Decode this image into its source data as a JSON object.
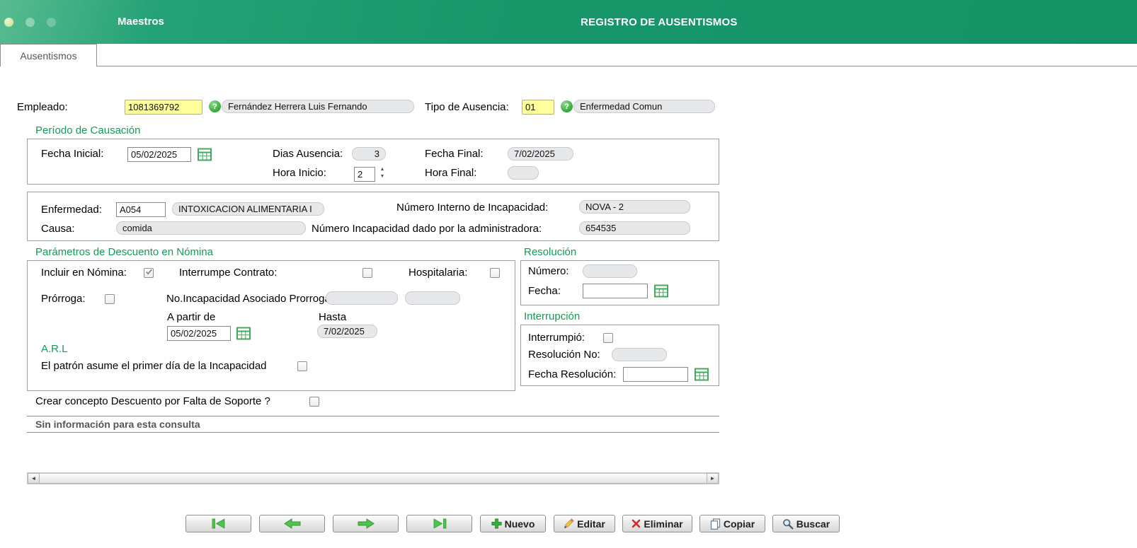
{
  "header": {
    "app_title": "Maestros",
    "screen_title": "REGISTRO DE AUSENTISMOS"
  },
  "tabs": {
    "ausentismos": "Ausentismos"
  },
  "icons": {
    "help_glyph": "?",
    "spin_up": "▲",
    "spin_down": "▼",
    "scroll_left": "◄",
    "scroll_right": "►"
  },
  "empleado": {
    "label": "Empleado:",
    "code": "1081369792",
    "name": "Fernández Herrera Luis Fernando",
    "tipo_label": "Tipo de Ausencia:",
    "tipo_code": "01",
    "tipo_name": "Enfermedad Comun"
  },
  "periodo": {
    "title": "Período de Causación",
    "fecha_inicial_label": "Fecha Inicial:",
    "fecha_inicial": "05/02/2025",
    "dias_label": "Dias Ausencia:",
    "dias": "3",
    "fecha_final_label": "Fecha Final:",
    "fecha_final": "7/02/2025",
    "hora_inicio_label": "Hora Inicio:",
    "hora_inicio": "2",
    "hora_final_label": "Hora Final:",
    "hora_final": ""
  },
  "incapacidad": {
    "enfermedad_label": "Enfermedad:",
    "enfermedad_code": "A054",
    "enfermedad_desc": "INTOXICACION ALIMENTARIA I",
    "num_interno_label": "Número Interno de Incapacidad:",
    "num_interno": "NOVA - 2",
    "causa_label": "Causa:",
    "causa": "comida",
    "num_admin_label": "Número Incapacidad dado por la administradora:",
    "num_admin": "654535"
  },
  "parametros": {
    "title": "Parámetros de Descuento en Nómina",
    "incluir_label": "Incluir en Nómina:",
    "incluir_checked": true,
    "interrumpe_label": "Interrumpe Contrato:",
    "hospitalaria_label": "Hospitalaria:",
    "prorroga_label": "Prórroga:",
    "no_incap_label": "No.Incapacidad Asociado Prorroga",
    "no_incap_1": "",
    "no_incap_2": "",
    "a_partir_label": "A partir de",
    "a_partir": "05/02/2025",
    "hasta_label": "Hasta",
    "hasta": "7/02/2025",
    "arl_title": "A.R.L",
    "patron_label": "El patrón asume el primer día de la Incapacidad"
  },
  "resolucion": {
    "title": "Resolución",
    "numero_label": "Número:",
    "numero": "",
    "fecha_label": "Fecha:",
    "fecha": ""
  },
  "interrupcion": {
    "title": "Interrupción",
    "interrumpio_label": "Interrumpió:",
    "resolucion_no_label": "Resolución No:",
    "resolucion_no": "",
    "fecha_resolucion_label": "Fecha Resolución:",
    "fecha_resolucion": ""
  },
  "soporte": {
    "label": "Crear concepto Descuento por Falta de Soporte ?"
  },
  "grid": {
    "empty_message": "Sin información para esta consulta"
  },
  "buttons": {
    "nuevo": "Nuevo",
    "editar": "Editar",
    "eliminar": "Eliminar",
    "copiar": "Copiar",
    "buscar": "Buscar"
  },
  "colors": {
    "header_green": "#18976b",
    "title_green": "#159a57",
    "yellow_input": "#ffff9c"
  }
}
